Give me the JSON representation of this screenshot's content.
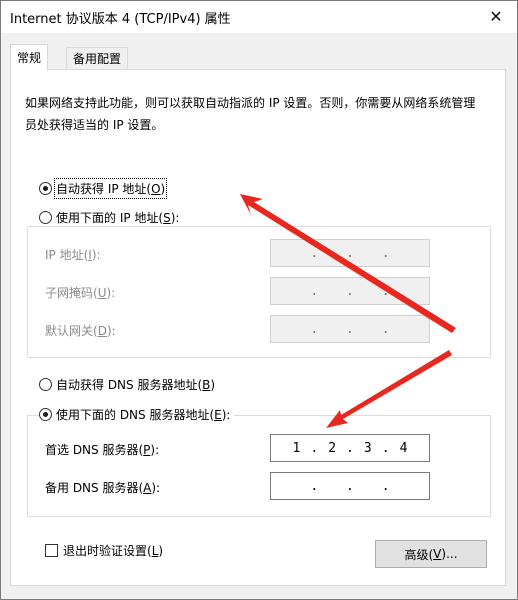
{
  "window": {
    "title": "Internet 协议版本 4 (TCP/IPv4) 属性",
    "close_glyph": "✕"
  },
  "tabs": [
    {
      "label": "常规",
      "active": true
    },
    {
      "label": "备用配置",
      "active": false
    }
  ],
  "description": "如果网络支持此功能，则可以获取自动指派的 IP 设置。否则，你需要从网络系统管理员处获得适当的 IP 设置。",
  "ip_section": {
    "auto_label": "自动获得 IP 地址(",
    "auto_key": "O",
    "auto_suffix": ")",
    "manual_label": "使用下面的 IP 地址(",
    "manual_key": "S",
    "manual_suffix": "):",
    "selected": "auto",
    "fields": [
      {
        "label": "IP 地址(",
        "key": "I",
        "suffix": "):",
        "octets": [
          "",
          "",
          "",
          ""
        ]
      },
      {
        "label": "子网掩码(",
        "key": "U",
        "suffix": "):",
        "octets": [
          "",
          "",
          "",
          ""
        ]
      },
      {
        "label": "默认网关(",
        "key": "D",
        "suffix": "):",
        "octets": [
          "",
          "",
          "",
          ""
        ]
      }
    ]
  },
  "dns_section": {
    "auto_label": "自动获得 DNS 服务器地址(",
    "auto_key": "B",
    "auto_suffix": ")",
    "manual_label": "使用下面的 DNS 服务器地址(",
    "manual_key": "E",
    "manual_suffix": "):",
    "selected": "manual",
    "fields": [
      {
        "label": "首选 DNS 服务器(",
        "key": "P",
        "suffix": "):",
        "octets": [
          "1",
          "2",
          "3",
          "4"
        ]
      },
      {
        "label": "备用 DNS 服务器(",
        "key": "A",
        "suffix": "):",
        "octets": [
          "",
          "",
          "",
          ""
        ]
      }
    ]
  },
  "validate_checkbox": {
    "label": "退出时验证设置(",
    "key": "L",
    "suffix": ")",
    "checked": false
  },
  "advanced_button": {
    "label": "高级(",
    "key": "V",
    "suffix": ")..."
  },
  "colors": {
    "annotation_arrow": "#e8281f",
    "panel_bg": "#ffffff",
    "window_bg": "#f0f0f0"
  },
  "icons": {
    "close": "close-icon",
    "annotation": "red-arrow-icon"
  }
}
